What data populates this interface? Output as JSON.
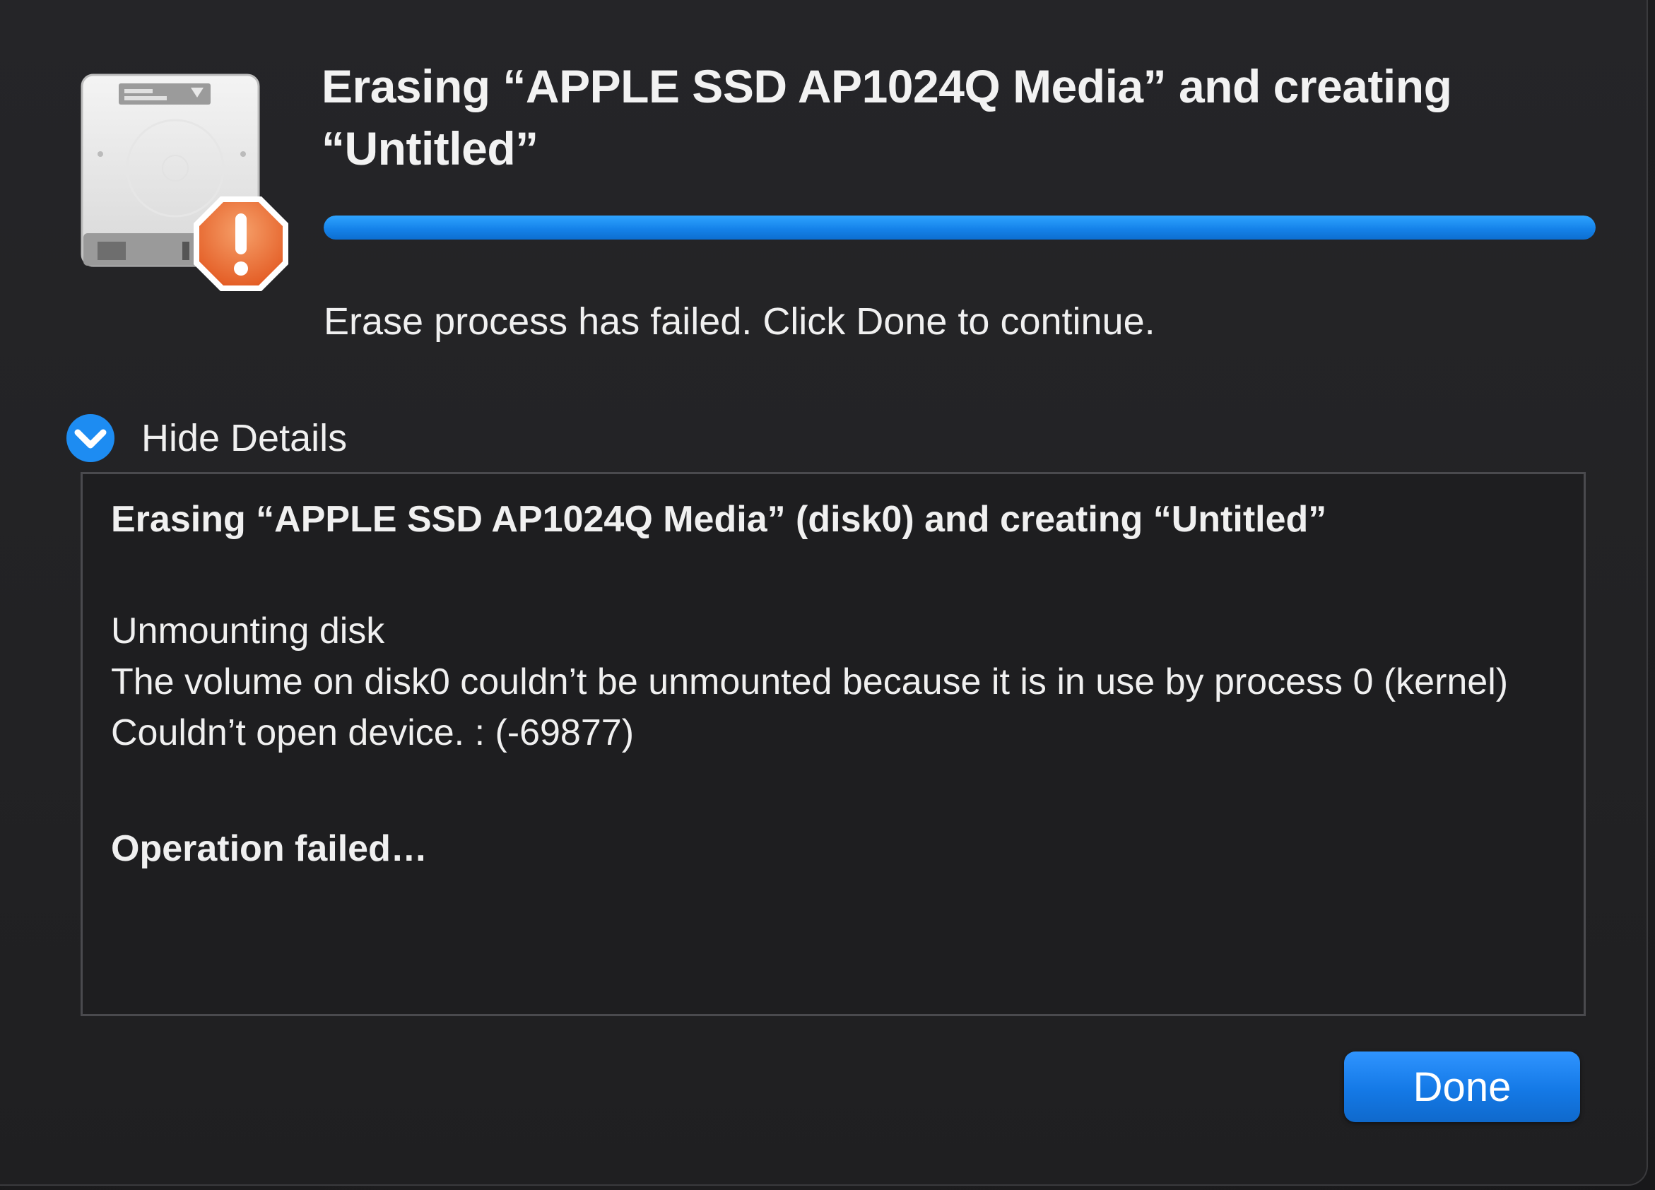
{
  "dialog": {
    "title": "Erasing “APPLE SSD AP1024Q Media” and creating “Untitled”",
    "progress_fraction": 1.0,
    "status": "Erase process has failed. Click Done to continue.",
    "disclosure_label": "Hide Details",
    "disclosure_icon": "chevron-down-icon",
    "disk_icon": "hard-disk-icon",
    "warning_icon": "warning-badge-icon",
    "details": {
      "line1": "Erasing “APPLE SSD AP1024Q Media” (disk0) and creating “Untitled”",
      "line2": "Unmounting disk",
      "line3": "The volume on disk0 couldn’t be unmounted because it is in use by process 0 (kernel)",
      "line4": "Couldn’t open device. : (-69877)",
      "line5": "Operation failed…"
    },
    "done_label": "Done"
  },
  "colors": {
    "accent": "#1583ea",
    "background": "#222224",
    "warning": "#ee6a2b"
  }
}
